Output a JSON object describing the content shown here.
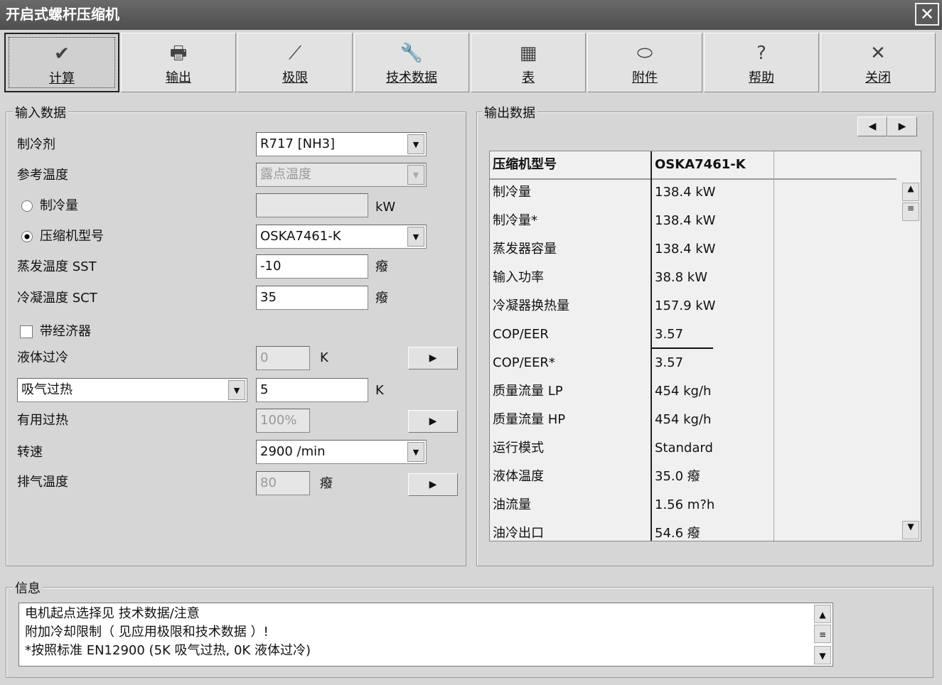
{
  "window": {
    "title": "开启式螺杆压缩机",
    "close": "✕"
  },
  "toolbar": [
    {
      "label": "计算",
      "icon": "✔"
    },
    {
      "label": "输出",
      "icon": "🖶"
    },
    {
      "label": "极限",
      "icon": "⟋"
    },
    {
      "label": "技术数据",
      "icon": "🔧"
    },
    {
      "label": "表",
      "icon": "▦"
    },
    {
      "label": "附件",
      "icon": "⬭"
    },
    {
      "label": "帮助",
      "icon": "?"
    },
    {
      "label": "关闭",
      "icon": "✕"
    }
  ],
  "input": {
    "title": "输入数据",
    "refrigerant_label": "制冷剂",
    "refrigerant": "R717 [NH3]",
    "reftemp_label": "参考温度",
    "reftemp": "露点温度",
    "capacity_label": "制冷量",
    "capacity_unit": "kW",
    "capacity": "",
    "model_label": "压缩机型号",
    "model": "OSKA7461-K",
    "sst_label": "蒸发温度 SST",
    "sst": "-10",
    "sst_unit": "癈",
    "sct_label": "冷凝温度 SCT",
    "sct": "35",
    "sct_unit": "癈",
    "economizer_label": "带经济器",
    "subcool_label": "液体过冷",
    "subcool": "0",
    "subcool_unit": "K",
    "superheat_select": "吸气过热",
    "superheat": "5",
    "superheat_unit": "K",
    "useful_label": "有用过热",
    "useful": "100%",
    "speed_label": "转速",
    "speed": "2900 /min",
    "discharge_label": "排气温度",
    "discharge": "80",
    "discharge_unit": "癈",
    "arrow": "▶"
  },
  "output": {
    "title": "输出数据",
    "prev": "◀",
    "next": "▶",
    "header": [
      "压缩机型号",
      "OSKA7461-K"
    ],
    "rows": [
      [
        "制冷量",
        "138.4 kW"
      ],
      [
        "制冷量*",
        "138.4 kW"
      ],
      [
        "蒸发器容量",
        "138.4 kW"
      ],
      [
        "输入功率",
        "38.8 kW"
      ],
      [
        "冷凝器换热量",
        "157.9 kW"
      ],
      [
        "COP/EER",
        "3.57"
      ],
      [
        "COP/EER*",
        "3.57"
      ],
      [
        "质量流量 LP",
        "454 kg/h"
      ],
      [
        "质量流量 HP",
        "454 kg/h"
      ],
      [
        "运行模式",
        "Standard"
      ],
      [
        "液体温度",
        "35.0 癈"
      ],
      [
        "油流量",
        "1.56 m?h"
      ],
      [
        "油冷出口",
        "54.6 癈"
      ]
    ]
  },
  "info": {
    "title": "信息",
    "lines": [
      "电机起点选择见 技术数据/注意",
      "附加冷却限制（ 见应用极限和技术数据 ）!",
      "*按照标准 EN12900 (5K 吸气过热, 0K 液体过冷)"
    ]
  }
}
